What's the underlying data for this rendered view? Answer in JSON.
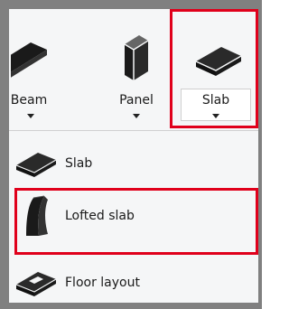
{
  "ribbon": {
    "tools": [
      {
        "label": "Beam",
        "visible_label": "Beam",
        "icon": "beam-icon"
      },
      {
        "label": "Panel",
        "icon": "panel-icon"
      },
      {
        "label": "Slab",
        "icon": "slab-icon",
        "highlighted": true
      }
    ]
  },
  "menu": {
    "items": [
      {
        "label": "Slab",
        "icon": "slab-icon"
      },
      {
        "label": "Lofted slab",
        "icon": "lofted-slab-icon",
        "highlighted": true
      },
      {
        "label": "Floor layout",
        "icon": "floor-layout-icon"
      }
    ]
  },
  "colors": {
    "highlight": "#e0001b",
    "icon_dark": "#1a1a1a",
    "background": "#f5f6f7",
    "border": "#808080"
  }
}
